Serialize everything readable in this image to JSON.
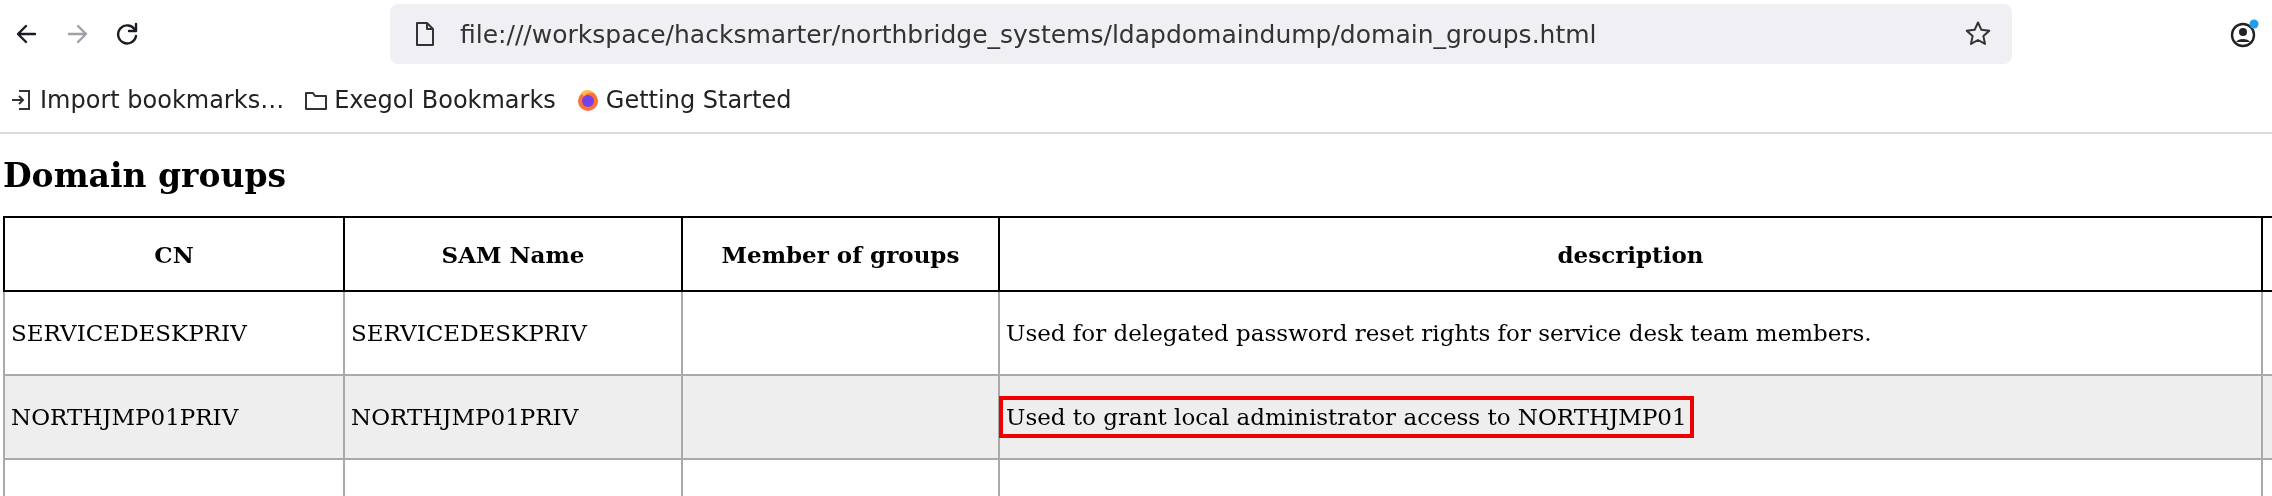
{
  "navigation": [
    {
      "kind": "back",
      "disabled": false
    },
    {
      "kind": "forward",
      "disabled": true
    },
    {
      "kind": "reload",
      "disabled": false
    }
  ],
  "address_bar": {
    "url": "file:///workspace/hacksmarter/northbridge_systems/ldapdomaindump/domain_groups.html"
  },
  "bookmarks": [
    {
      "kind": "import",
      "label": "Import bookmarks…"
    },
    {
      "kind": "folder",
      "label": "Exegol Bookmarks"
    },
    {
      "kind": "firefox",
      "label": "Getting Started"
    }
  ],
  "page": {
    "heading": "Domain groups",
    "table": {
      "columns": [
        "CN",
        "SAM Name",
        "Member of groups",
        "description"
      ],
      "rows": [
        {
          "cn": "SERVICEDESKPRIV",
          "sam_name": "SERVICEDESKPRIV",
          "description": "Used for delegated password reset rights for service desk team members.",
          "description_highlighted": false
        },
        {
          "cn": "NORTHJMP01PRIV",
          "sam_name": "NORTHJMP01PRIV",
          "description": "Used to grant local administrator access to NORTHJMP01",
          "description_highlighted": true
        }
      ]
    }
  }
}
